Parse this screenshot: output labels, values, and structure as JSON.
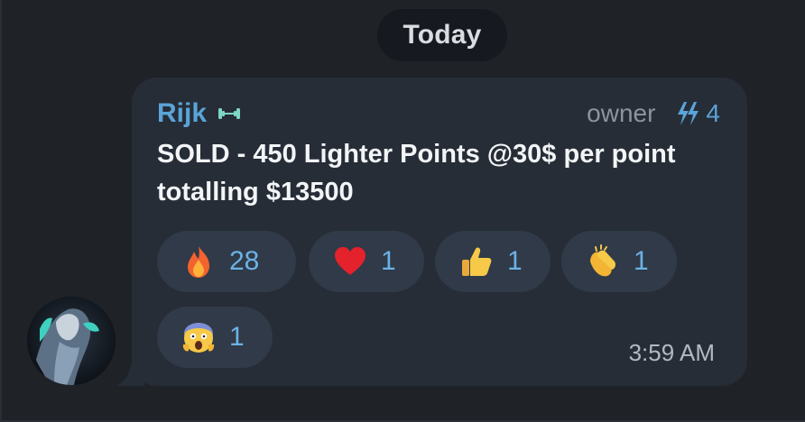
{
  "date_separator": "Today",
  "message": {
    "sender": "Rijk",
    "sender_emoji": "dumbbell-emoji",
    "role": "owner",
    "boost_count": "4",
    "boost_icon": "boost-icon",
    "text": "SOLD - 450 Lighter Points @30$ per point totalling $13500",
    "time": "3:59 AM",
    "reactions": [
      {
        "emoji": "fire",
        "count": "28"
      },
      {
        "emoji": "red-heart",
        "count": "1"
      },
      {
        "emoji": "thumbs-up",
        "count": "1"
      },
      {
        "emoji": "clapping-hands",
        "count": "1"
      },
      {
        "emoji": "screaming-face",
        "count": "1"
      }
    ]
  },
  "colors": {
    "background": "#1f2227",
    "bubble": "#262d37",
    "reaction_chip": "#303a48",
    "accent": "#5aa4d9",
    "text": "#f2f4f6",
    "muted": "#8d949c"
  }
}
